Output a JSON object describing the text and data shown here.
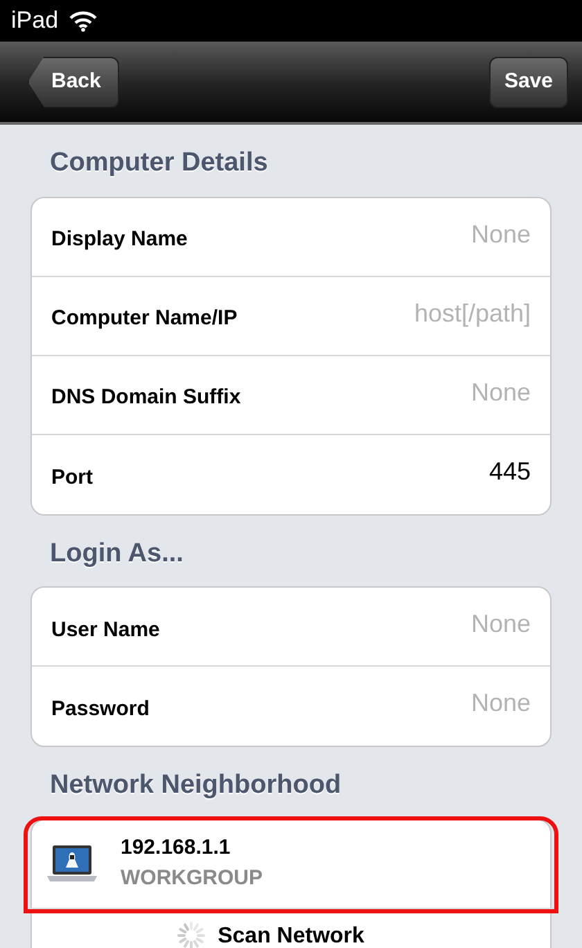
{
  "status_bar": {
    "device": "iPad"
  },
  "nav_bar": {
    "back": "Back",
    "save": "Save"
  },
  "sections": [
    {
      "title": "Computer Details",
      "rows": [
        {
          "kind": "field",
          "label": "Display Name",
          "placeholder": "None"
        },
        {
          "kind": "field",
          "label": "Computer Name/IP",
          "placeholder": "host[/path]"
        },
        {
          "kind": "field",
          "label": "DNS Domain Suffix",
          "placeholder": "None"
        },
        {
          "kind": "field",
          "label": "Port",
          "value": "445"
        }
      ]
    },
    {
      "title": "Login As...",
      "rows": [
        {
          "kind": "field",
          "label": "User Name",
          "placeholder": "None"
        },
        {
          "kind": "field",
          "label": "Password",
          "placeholder": "None"
        }
      ]
    },
    {
      "title": "Network Neighborhood",
      "rows": [
        {
          "kind": "computer",
          "label": "192.168.1.1",
          "value": "WORKGROUP",
          "highlighted": true
        },
        {
          "kind": "action",
          "label": "Scan Network"
        }
      ]
    }
  ]
}
